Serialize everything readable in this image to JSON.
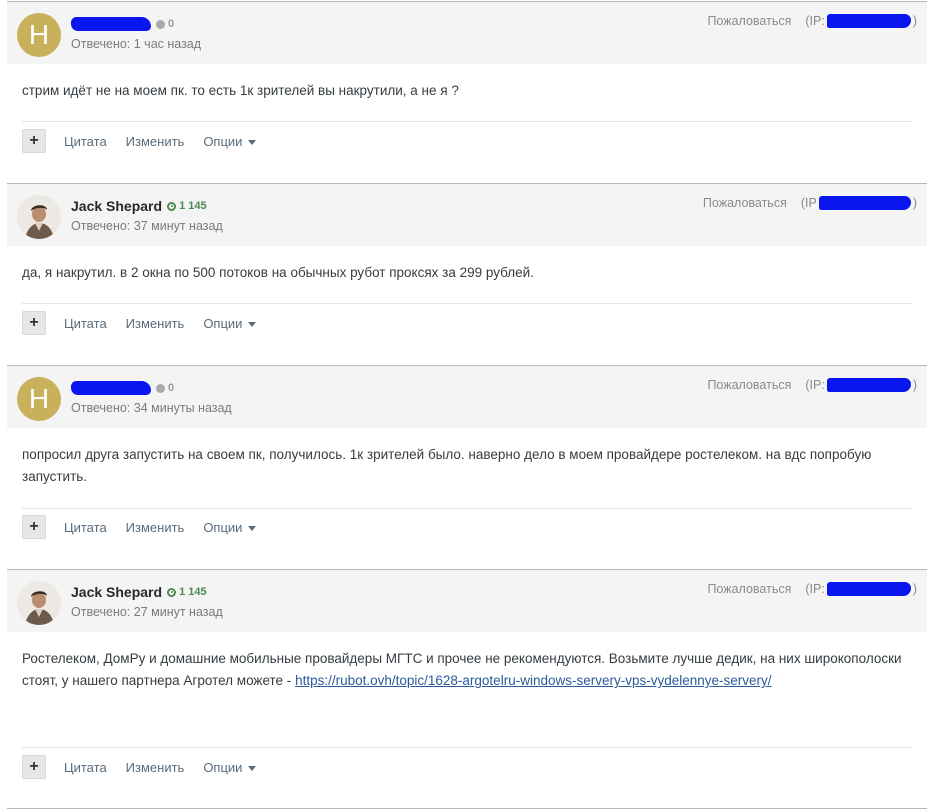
{
  "posts": [
    {
      "avatar_letter": "H",
      "author": "",
      "rep": "0",
      "answered": "Отвечено: 1 час назад",
      "report": "Пожаловаться",
      "ip_prefix": "(IP:",
      "ip_suffix": ")",
      "text": "стрим идёт не на моем пк. то есть 1к зрителей вы накрутили, а не я ?",
      "actions": {
        "quote": "Цитата",
        "edit": "Изменить",
        "options": "Опции",
        "plus": "+"
      }
    },
    {
      "author": "Jack Shepard",
      "rep": "1 145",
      "answered": "Отвечено: 37 минут назад",
      "report": "Пожаловаться",
      "ip_prefix": "(IP",
      "ip_suffix": ")",
      "text": "да, я накрутил. в 2 окна по 500 потоков на обычных рубот проксях за 299 рублей.",
      "actions": {
        "quote": "Цитата",
        "edit": "Изменить",
        "options": "Опции",
        "plus": "+"
      }
    },
    {
      "avatar_letter": "H",
      "author": "",
      "rep": "0",
      "answered": "Отвечено: 34 минуты назад",
      "report": "Пожаловаться",
      "ip_prefix": "(IP:",
      "ip_suffix": ")",
      "text": "попросил друга запустить на своем пк, получилось. 1к зрителей было. наверно дело в моем провайдере ростелеком. на вдс попробую запустить.",
      "actions": {
        "quote": "Цитата",
        "edit": "Изменить",
        "options": "Опции",
        "plus": "+"
      }
    },
    {
      "author": "Jack Shepard",
      "rep": "1 145",
      "answered": "Отвечено: 27 минут назад",
      "report": "Пожаловаться",
      "ip_prefix": "(IP:",
      "ip_suffix": ")",
      "text": "Ростелеком, ДомРу и домашние мобильные провайдеры МГТС и прочее не рекомендуются. Возьмите лучше дедик, на них широкополоски стоят, у нашего партнера Агротел можете - ",
      "link": "https://rubot.ovh/topic/1628-argotelru-windows-servery-vps-vydelennye-servery/",
      "actions": {
        "quote": "Цитата",
        "edit": "Изменить",
        "options": "Опции",
        "plus": "+"
      }
    }
  ]
}
